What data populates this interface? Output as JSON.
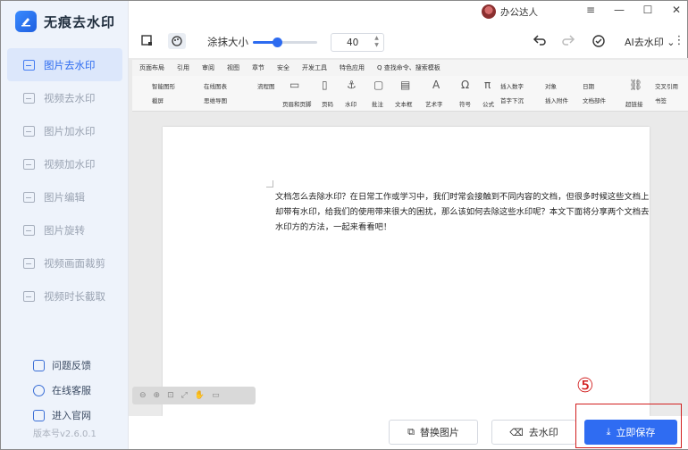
{
  "app": {
    "name": "无痕去水印",
    "version": "版本号v2.6.0.1"
  },
  "sidebar": {
    "items": [
      {
        "label": "图片去水印",
        "icon": "image-icon",
        "active": true
      },
      {
        "label": "视频去水印",
        "icon": "video-icon",
        "active": false
      },
      {
        "label": "图片加水印",
        "icon": "image-add-icon",
        "active": false
      },
      {
        "label": "视频加水印",
        "icon": "video-add-icon",
        "active": false
      },
      {
        "label": "图片编辑",
        "icon": "image-edit-icon",
        "active": false
      },
      {
        "label": "图片旋转",
        "icon": "rotate-icon",
        "active": false
      },
      {
        "label": "视频画面裁剪",
        "icon": "crop-icon",
        "active": false
      },
      {
        "label": "视频时长截取",
        "icon": "clip-icon",
        "active": false
      }
    ],
    "links": [
      {
        "label": "问题反馈",
        "icon": "feedback-icon"
      },
      {
        "label": "在线客服",
        "icon": "service-icon"
      },
      {
        "label": "进入官网",
        "icon": "website-icon"
      }
    ]
  },
  "titlebar": {
    "user_name": "办公达人",
    "dropdown": "≡",
    "min": "—",
    "max": "☐",
    "close": "✕"
  },
  "toolbar": {
    "brush_label": "涂抹大小",
    "brush_value": "40",
    "brush_fraction": 0.38,
    "ai_label": "AI去水印"
  },
  "document": {
    "tabs": [
      "页面布局",
      "引用",
      "审阅",
      "视图",
      "章节",
      "安全",
      "开发工具",
      "特色应用",
      "Q 查找命令、搜索模板"
    ],
    "ribbon": [
      "智能图形",
      "在线图表",
      "流程图",
      "截屏",
      "思维导图",
      "页眉和页脚",
      "页码",
      "水印",
      "批注",
      "文本框",
      "艺术字",
      "符号",
      "公式",
      "插入数字",
      "对象",
      "日期",
      "首字下沉",
      "插入附件",
      "文档部件",
      "超链接",
      "书签",
      "交叉引用"
    ],
    "body": "文档怎么去除水印？在日常工作或学习中，我们时常会接触到不同内容的文档，但很多时候这些文档上却带有水印，给我们的使用带来很大的困扰，那么该如何去除这些水印呢？本文下面将分享两个文档去水印方的方法，一起来看看吧！"
  },
  "bottom": {
    "replace_label": "替换图片",
    "remove_label": "去水印",
    "save_label": "立即保存"
  },
  "annotation": {
    "step": "⑤"
  },
  "colors": {
    "accent": "#2f6cf2",
    "annotation": "#d21f1f",
    "sidebar_bg": "#eef3fb"
  }
}
